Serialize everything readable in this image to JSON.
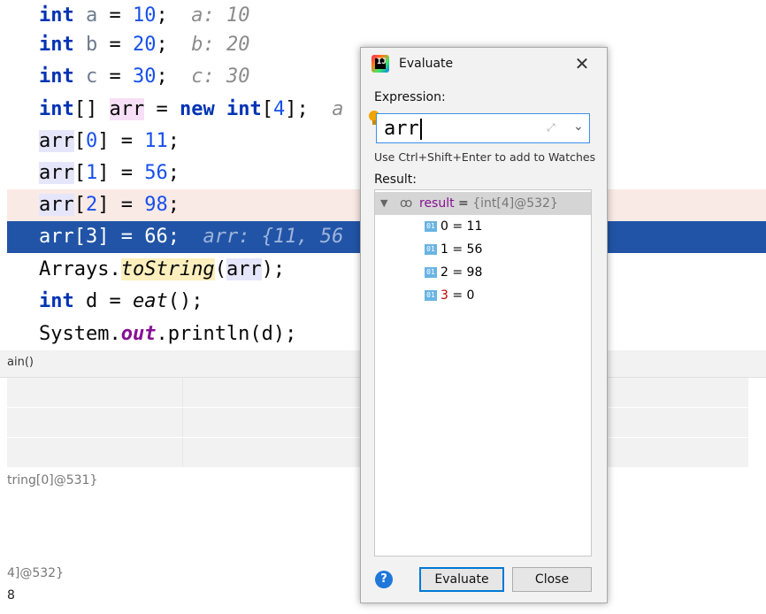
{
  "editor": {
    "lines": [
      {
        "kw": "int",
        "name": " a",
        "rest": " = ",
        "num": "10",
        "semi": ";",
        "hint": "a: 10"
      },
      {
        "kw": "int",
        "name": " b",
        "rest": " = ",
        "num": "20",
        "semi": ";",
        "hint": "b: 20"
      },
      {
        "kw": "int",
        "name": " c",
        "rest": " = ",
        "num": "30",
        "semi": ";",
        "hint": "c: 30"
      }
    ],
    "line4": {
      "kw1": "int",
      "br": "[] ",
      "arr": "arr",
      "eq": " = ",
      "kw2": "new",
      "sp": " ",
      "kw3": "int",
      "dim_open": "[",
      "dim": "4",
      "dim_close": "];",
      "hint": "a"
    },
    "assign": [
      {
        "target": "arr",
        "index": "[",
        "idx": "0",
        "close": "] = ",
        "val": "11",
        "semi": ";"
      },
      {
        "target": "arr",
        "index": "[",
        "idx": "1",
        "close": "] = ",
        "val": "56",
        "semi": ";"
      },
      {
        "target": "arr",
        "index": "[",
        "idx": "2",
        "close": "] = ",
        "val": "98",
        "semi": ";"
      },
      {
        "target": "arr",
        "index": "[",
        "idx": "3",
        "close": "] = ",
        "val": "66",
        "semi": ";",
        "hint": "arr: {11, 56"
      }
    ],
    "line9": {
      "cls": "Arrays.",
      "method": "toString",
      "open": "(",
      "arg": "arr",
      "close": ");"
    },
    "line10": {
      "kw": "int",
      "rest": " d = ",
      "method": "eat",
      "close": "();"
    },
    "line11": {
      "cls": "System.",
      "field": "out",
      "rest": ".println(d);"
    }
  },
  "frames": {
    "header": "ain()"
  },
  "variables": {
    "line1": "tring[0]@531}",
    "line2": "4]@532}",
    "line3": "8"
  },
  "dialog": {
    "title": "Evaluate",
    "expression_label": "Expression:",
    "expression_value": "arr",
    "hint": "Use Ctrl+Shift+Enter to add to Watches",
    "result_label": "Result:",
    "result": {
      "name": "result",
      "eq": " = ",
      "ref": "{int[4]@532}",
      "children": [
        {
          "idx": "0",
          "val": " = 11"
        },
        {
          "idx": "1",
          "val": " = 56"
        },
        {
          "idx": "2",
          "val": " = 98"
        },
        {
          "idx": "3",
          "val": " = 0"
        }
      ]
    },
    "evaluate_button": "Evaluate",
    "close_button": "Close",
    "help": "?"
  }
}
